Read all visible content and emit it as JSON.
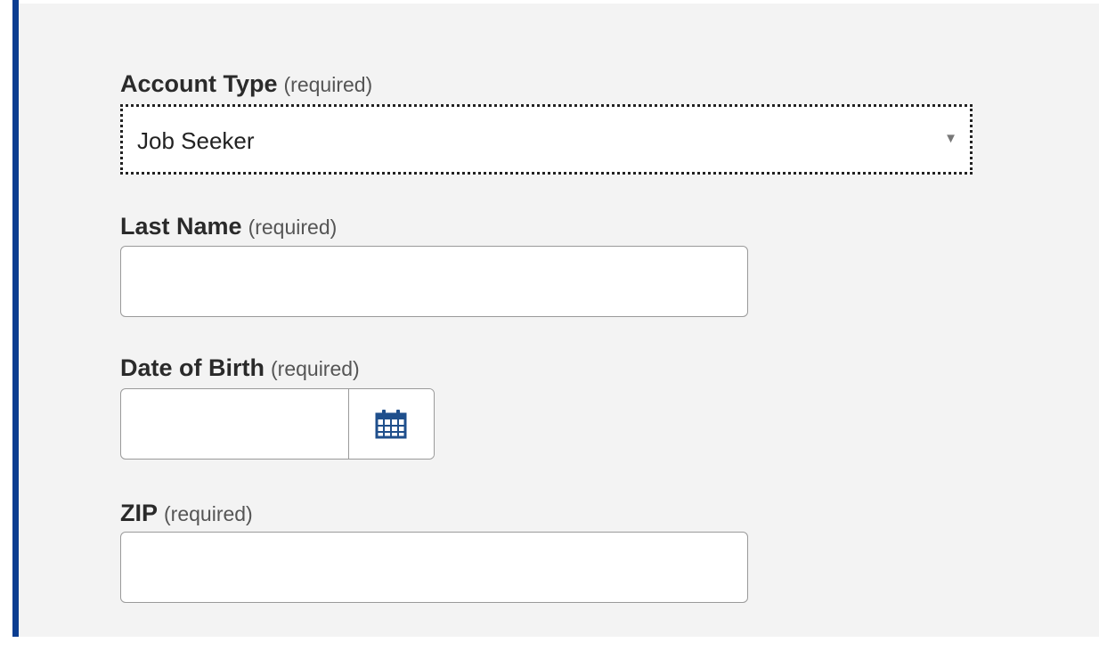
{
  "form": {
    "account_type": {
      "label": "Account Type",
      "required_text": "(required)",
      "selected_value": "Job Seeker",
      "arrow_icon": "dropdown-arrow-icon"
    },
    "last_name": {
      "label": "Last Name",
      "required_text": "(required)",
      "value": "",
      "placeholder": ""
    },
    "date_of_birth": {
      "label": "Date of Birth",
      "required_text": "(required)",
      "value": "",
      "placeholder": "",
      "picker_icon": "calendar-icon"
    },
    "zip": {
      "label": "ZIP",
      "required_text": "(required)",
      "value": "",
      "placeholder": ""
    }
  },
  "colors": {
    "accent_bar": "#0b3d91",
    "panel_background": "#f3f3f3",
    "calendar_icon": "#1f4f8c"
  }
}
